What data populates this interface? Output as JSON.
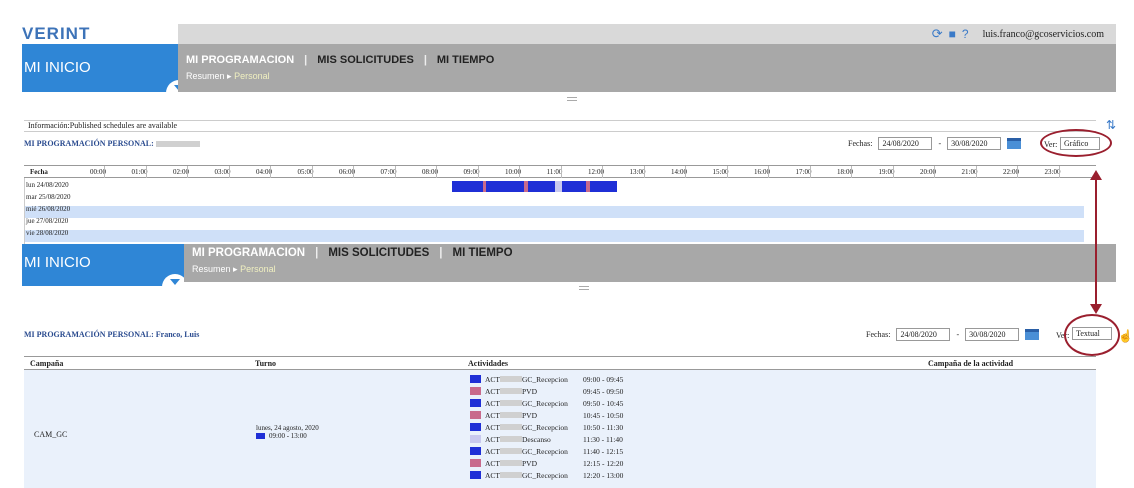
{
  "header": {
    "logo": "VERINT",
    "user_email": "luis.franco@gcoservicios.com",
    "icons": [
      "refresh-icon",
      "print-icon",
      "help-icon"
    ]
  },
  "nav": {
    "inicio": "MI INICIO",
    "tabs": [
      "MI PROGRAMACION",
      "MIS SOLICITUDES",
      "MI TIEMPO"
    ],
    "sub": [
      "Resumen",
      "Personal"
    ]
  },
  "top_panel": {
    "info": "Información:Published schedules are available",
    "title": "MI PROGRAMACIÓN PERSONAL:",
    "fechas_label": "Fechas:",
    "date_from": "24/08/2020",
    "date_to": "30/08/2020",
    "ver_label": "Ver:",
    "ver_value": "Gráfico"
  },
  "grid": {
    "fecha_label": "Fecha",
    "hours": [
      "00:00",
      "01:00",
      "02:00",
      "03:00",
      "04:00",
      "05:00",
      "06:00",
      "07:00",
      "08:00",
      "09:00",
      "10:00",
      "11:00",
      "12:00",
      "13:00",
      "14:00",
      "15:00",
      "16:00",
      "17:00",
      "18:00",
      "19:00",
      "20:00",
      "21:00",
      "22:00",
      "23:00"
    ],
    "days": [
      "lun 24/08/2020",
      "mar 25/08/2020",
      "mié 26/08/2020",
      "jue 27/08/2020",
      "vie 28/08/2020"
    ]
  },
  "bottom_panel": {
    "title": "MI PROGRAMACIÓN PERSONAL: Franco, Luis",
    "fechas_label": "Fechas:",
    "date_from": "24/08/2020",
    "date_to": "30/08/2020",
    "ver_label": "Ver:",
    "ver_value": "Textual"
  },
  "table": {
    "headers": [
      "Campaña",
      "Turno",
      "Actividades",
      "Campaña de la actividad"
    ],
    "campaign": "CAM_GC",
    "turno_date": "lunes, 24 agosto, 2020",
    "turno_time": "09:00 - 13:00",
    "activities": [
      {
        "prefix": "ACT",
        "suffix": "GC_Recepcion",
        "time": "09:00 - 09:45",
        "color": "#1f2fd6"
      },
      {
        "prefix": "ACT",
        "suffix": "PVD",
        "time": "09:45 - 09:50",
        "color": "#c86a8c"
      },
      {
        "prefix": "ACT",
        "suffix": "GC_Recepcion",
        "time": "09:50 - 10:45",
        "color": "#1f2fd6"
      },
      {
        "prefix": "ACT",
        "suffix": "PVD",
        "time": "10:45 - 10:50",
        "color": "#c86a8c"
      },
      {
        "prefix": "ACT",
        "suffix": "GC_Recepcion",
        "time": "10:50 - 11:30",
        "color": "#1f2fd6"
      },
      {
        "prefix": "ACT",
        "suffix": "Descanso",
        "time": "11:30 - 11:40",
        "color": "#c9c9ee"
      },
      {
        "prefix": "ACT",
        "suffix": "GC_Recepcion",
        "time": "11:40 - 12:15",
        "color": "#1f2fd6"
      },
      {
        "prefix": "ACT",
        "suffix": "PVD",
        "time": "12:15 - 12:20",
        "color": "#c86a8c"
      },
      {
        "prefix": "ACT",
        "suffix": "GC_Recepcion",
        "time": "12:20 - 13:00",
        "color": "#1f2fd6"
      }
    ]
  }
}
